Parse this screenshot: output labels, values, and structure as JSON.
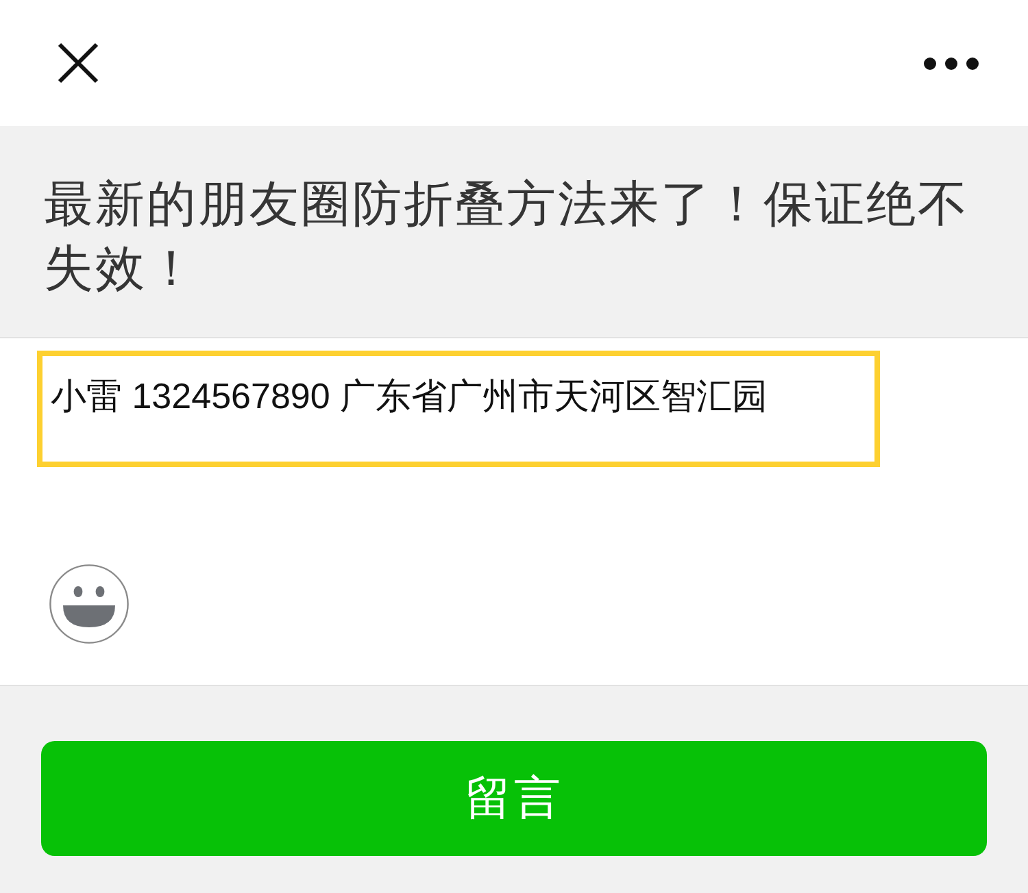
{
  "article": {
    "title": "最新的朋友圈防折叠方法来了！保证绝不失效！"
  },
  "comment": {
    "value": "小雷 1324567890 广东省广州市天河区智汇园",
    "highlighted": true
  },
  "submit_button": {
    "label": "留言"
  }
}
